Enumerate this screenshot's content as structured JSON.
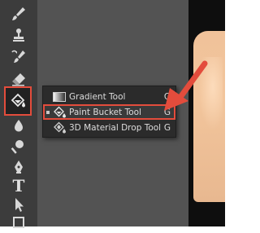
{
  "toolbar": {
    "tools": [
      {
        "name": "brush-tool",
        "icon": "brush-icon"
      },
      {
        "name": "clone-stamp-tool",
        "icon": "stamp-icon"
      },
      {
        "name": "history-brush-tool",
        "icon": "history-brush-icon"
      },
      {
        "name": "eraser-tool",
        "icon": "eraser-icon"
      },
      {
        "name": "paint-bucket-tool",
        "icon": "paint-bucket-icon",
        "active": true
      },
      {
        "name": "blur-tool",
        "icon": "droplet-icon"
      },
      {
        "name": "dodge-tool",
        "icon": "dodge-icon"
      },
      {
        "name": "pen-tool",
        "icon": "pen-icon"
      },
      {
        "name": "type-tool",
        "icon": "type-icon",
        "glyph": "T"
      },
      {
        "name": "path-selection-tool",
        "icon": "arrow-pointer-icon"
      },
      {
        "name": "rectangle-tool",
        "icon": "rectangle-icon"
      }
    ]
  },
  "flyout": {
    "items": [
      {
        "label": "Gradient Tool",
        "shortcut": "G",
        "icon": "gradient-icon",
        "selected": false
      },
      {
        "label": "Paint Bucket Tool",
        "shortcut": "G",
        "icon": "paint-bucket-icon",
        "selected": true
      },
      {
        "label": "3D Material Drop Tool",
        "shortcut": "G",
        "icon": "material-drop-icon",
        "selected": false
      }
    ]
  },
  "colors": {
    "highlight": "#e34c3c",
    "toolbar_bg": "#3c3c3c",
    "menu_bg": "#2b2b2b"
  }
}
